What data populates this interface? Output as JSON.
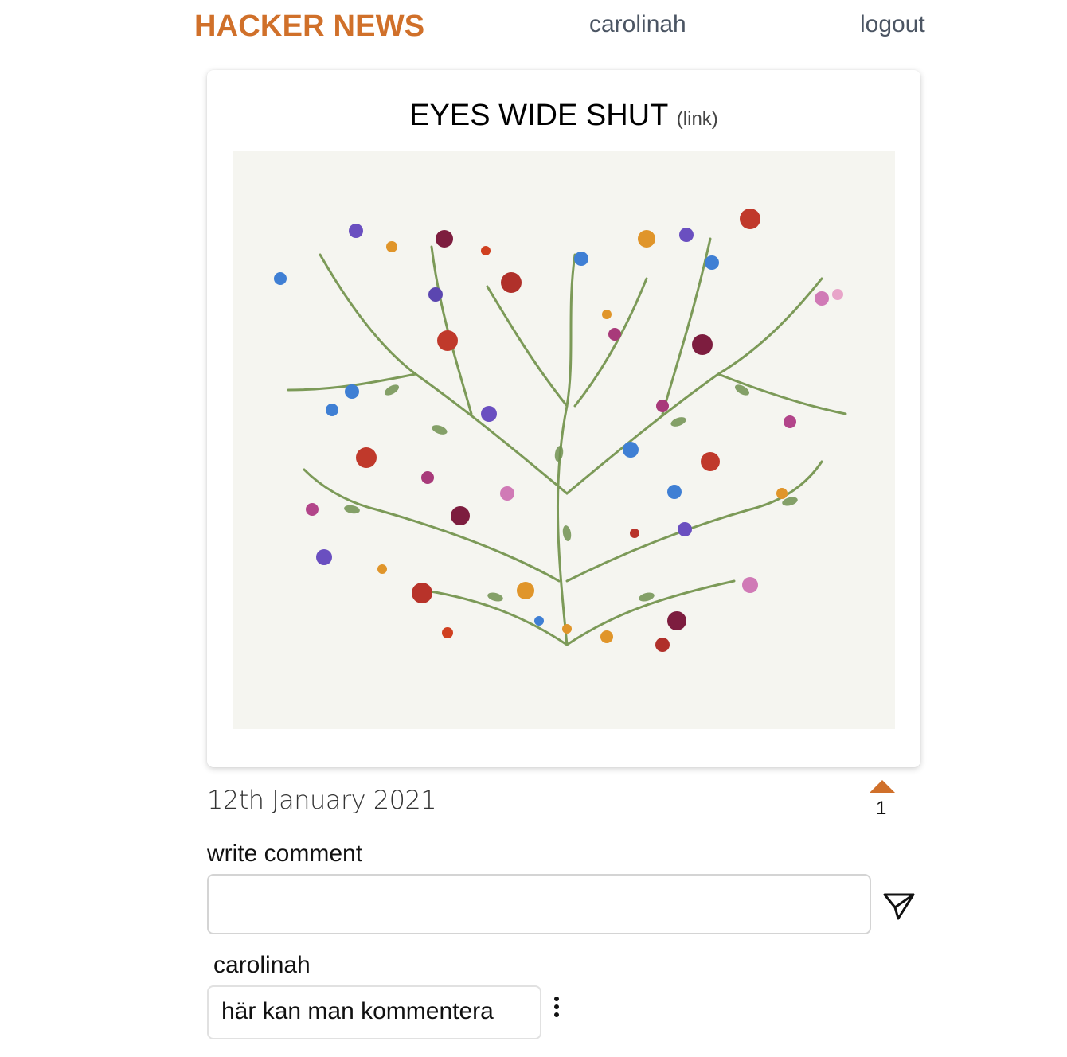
{
  "header": {
    "brand": "HACKER NEWS",
    "username": "carolinah",
    "logout": "logout"
  },
  "post": {
    "title": "EYES WIDE SHUT",
    "link_label": "(link)",
    "date": "12th January 2021",
    "votes": "1",
    "image_alt": "botanical floral illustration"
  },
  "comment_form": {
    "label": "write comment",
    "value": "",
    "placeholder": "",
    "submit_icon": "send-icon"
  },
  "comments": [
    {
      "author": "carolinah",
      "text": "här kan man kommentera",
      "menu_icon": "more-vertical-icon"
    }
  ],
  "colors": {
    "accent": "#d0702a",
    "nav_text": "#4b5563",
    "image_bg": "#f5f5f0"
  }
}
